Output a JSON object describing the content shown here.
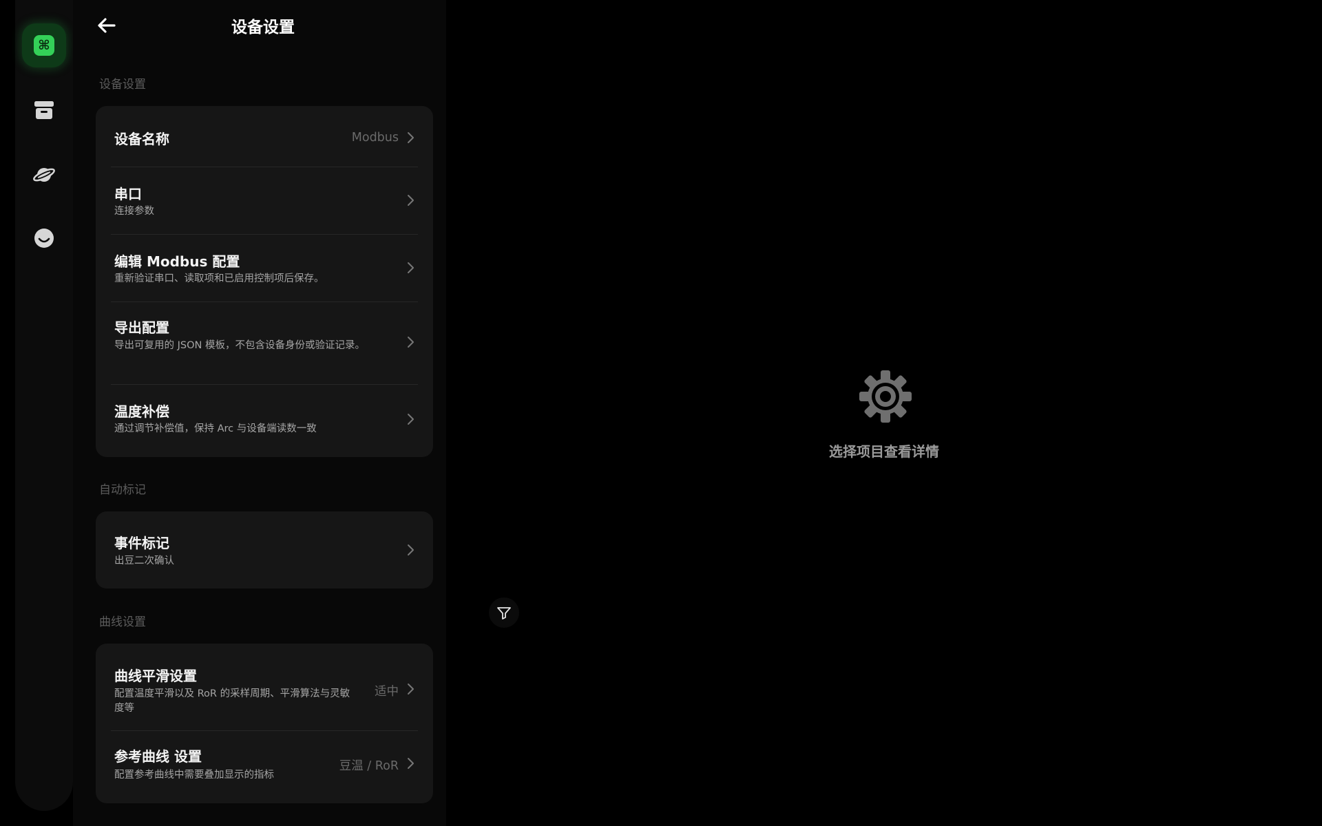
{
  "rail": {
    "items": [
      {
        "name": "command",
        "icon": "command-icon",
        "active": true
      },
      {
        "name": "archive",
        "icon": "archive-box-icon",
        "active": false
      },
      {
        "name": "planet",
        "icon": "planet-icon",
        "active": false
      },
      {
        "name": "profile",
        "icon": "smiley-face-icon",
        "active": false
      }
    ],
    "command_glyph": "⌘",
    "accent": "#34d058"
  },
  "header": {
    "title": "设备设置",
    "back_icon": "arrow-left-icon"
  },
  "sections": [
    {
      "label": "设备设置",
      "items": [
        {
          "title": "设备名称",
          "value": "Modbus"
        },
        {
          "title": "串口",
          "subtitle": "连接参数"
        },
        {
          "title": "编辑 Modbus 配置",
          "subtitle": "重新验证串口、读取项和已启用控制项后保存。"
        },
        {
          "title": "导出配置",
          "subtitle": "导出可复用的 JSON 模板，不包含设备身份或验证记录。"
        },
        {
          "title": "温度补偿",
          "subtitle": "通过调节补偿值，保持 Arc 与设备端读数一致"
        }
      ]
    },
    {
      "label": "自动标记",
      "items": [
        {
          "title": "事件标记",
          "subtitle": "出豆二次确认"
        }
      ]
    },
    {
      "label": "曲线设置",
      "items": [
        {
          "title": "曲线平滑设置",
          "subtitle": "配置温度平滑以及 RoR 的采样周期、平滑算法与灵敏度等",
          "value": "适中"
        },
        {
          "title": "参考曲线 设置",
          "subtitle": "配置参考曲线中需要叠加显示的指标",
          "value": "豆温 / RoR"
        }
      ]
    }
  ],
  "detail": {
    "icon": "gear-icon",
    "placeholder_text": "选择项目查看详情"
  },
  "filter": {
    "icon": "filter-funnel-icon"
  },
  "colors": {
    "background": "#000000",
    "panel": "#080808",
    "card": "#161616",
    "accent": "#34d058",
    "muted_text": "#5c5c5c"
  }
}
